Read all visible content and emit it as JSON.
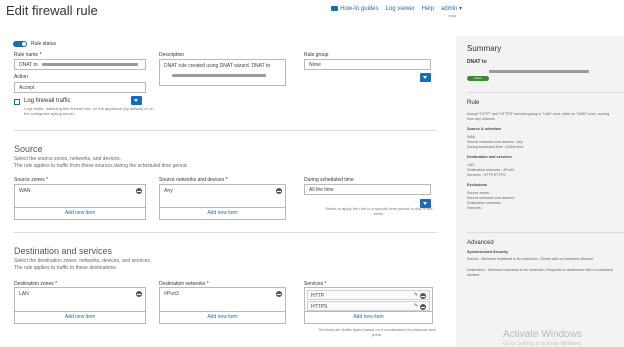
{
  "header": {
    "title": "Edit firewall rule",
    "links": {
      "how_to": "How-to guides",
      "log_viewer": "Log viewer",
      "help": "Help",
      "admin": "admin ▾"
    },
    "admin_sub": "Insp"
  },
  "rule_status": {
    "label": "Rule status",
    "on": true
  },
  "rule_name": {
    "label": "Rule name *",
    "value": "DNAT to"
  },
  "description": {
    "label": "Description",
    "line1": "DNAT rule created using DNAT wizard. DNAT to"
  },
  "rule_group": {
    "label": "Rule group",
    "value": "None"
  },
  "action": {
    "label": "Action",
    "value": "Accept"
  },
  "log_traffic": {
    "label": "Log firewall traffic",
    "desc": "Logs traffic, matching this firewall rule, on the appliance (by default) or on the configured syslog server."
  },
  "source": {
    "title": "Source",
    "desc1": "Select the source zones, networks, and devices.",
    "desc2": "The rule applies to traffic from these sources during the scheduled time period.",
    "zones_label": "Source zones *",
    "zones": [
      "WAN"
    ],
    "networks_label": "Source networks and devices *",
    "networks": [
      "Any"
    ],
    "schedule_label": "During scheduled time",
    "schedule_value": "All the time",
    "schedule_help": "Select to apply the rule to a specific time period or day of the week.",
    "add_label": "Add new item"
  },
  "destination": {
    "title": "Destination and services",
    "desc1": "Select the destination zones, networks, devices, and services.",
    "desc2": "The rule applies to traffic to these destinations.",
    "zones_label": "Destination zones *",
    "zones": [
      "LAN"
    ],
    "networks_label": "Destination networks *",
    "networks": [
      "#Port3"
    ],
    "services_label": "Services *",
    "services": [
      "HTTP",
      "HTTPS"
    ],
    "services_help": "Services are traffic types based on a combination of protocols and ports.",
    "add_label": "Add new item"
  },
  "summary": {
    "title": "Summary",
    "rule_name": "DNAT to",
    "badge": "Active",
    "rule_heading": "Rule",
    "rule_desc": "Accept \"HTTP\" and \"HTTPS\" services going to \"LAN\" zone, sited on \"WAN\" zone, coming from any network.",
    "src_sched_h": "Source & schedule",
    "src_sched_lines": [
      "WAN",
      "Source networks and devices : Any",
      "During scheduled time : All the time"
    ],
    "dest_h": "Destination and services",
    "dest_lines": [
      "LAN",
      "Destination networks : #Port3",
      "Services : HTTP,HTTPS"
    ],
    "excl_h": "Exclusions",
    "excl_lines": [
      "Source zones :",
      "Source networks and devices :",
      "Destination networks :",
      "Services :"
    ],
    "advanced_h": "Advanced",
    "sync_h": "Synchronized Security",
    "sync_lines": [
      "Source : Minimum heartbeat is No restriction, Clients with no heartbeat allowed",
      "Destination : Minimum heartbeat is No restriction, Requests to destination with no heartbeat allowed"
    ]
  },
  "watermark": {
    "title": "Activate Windows",
    "sub": "Go to Settings to activate Windows."
  },
  "colors": {
    "accent": "#1a6db5",
    "active_badge": "#3a8a2f"
  }
}
